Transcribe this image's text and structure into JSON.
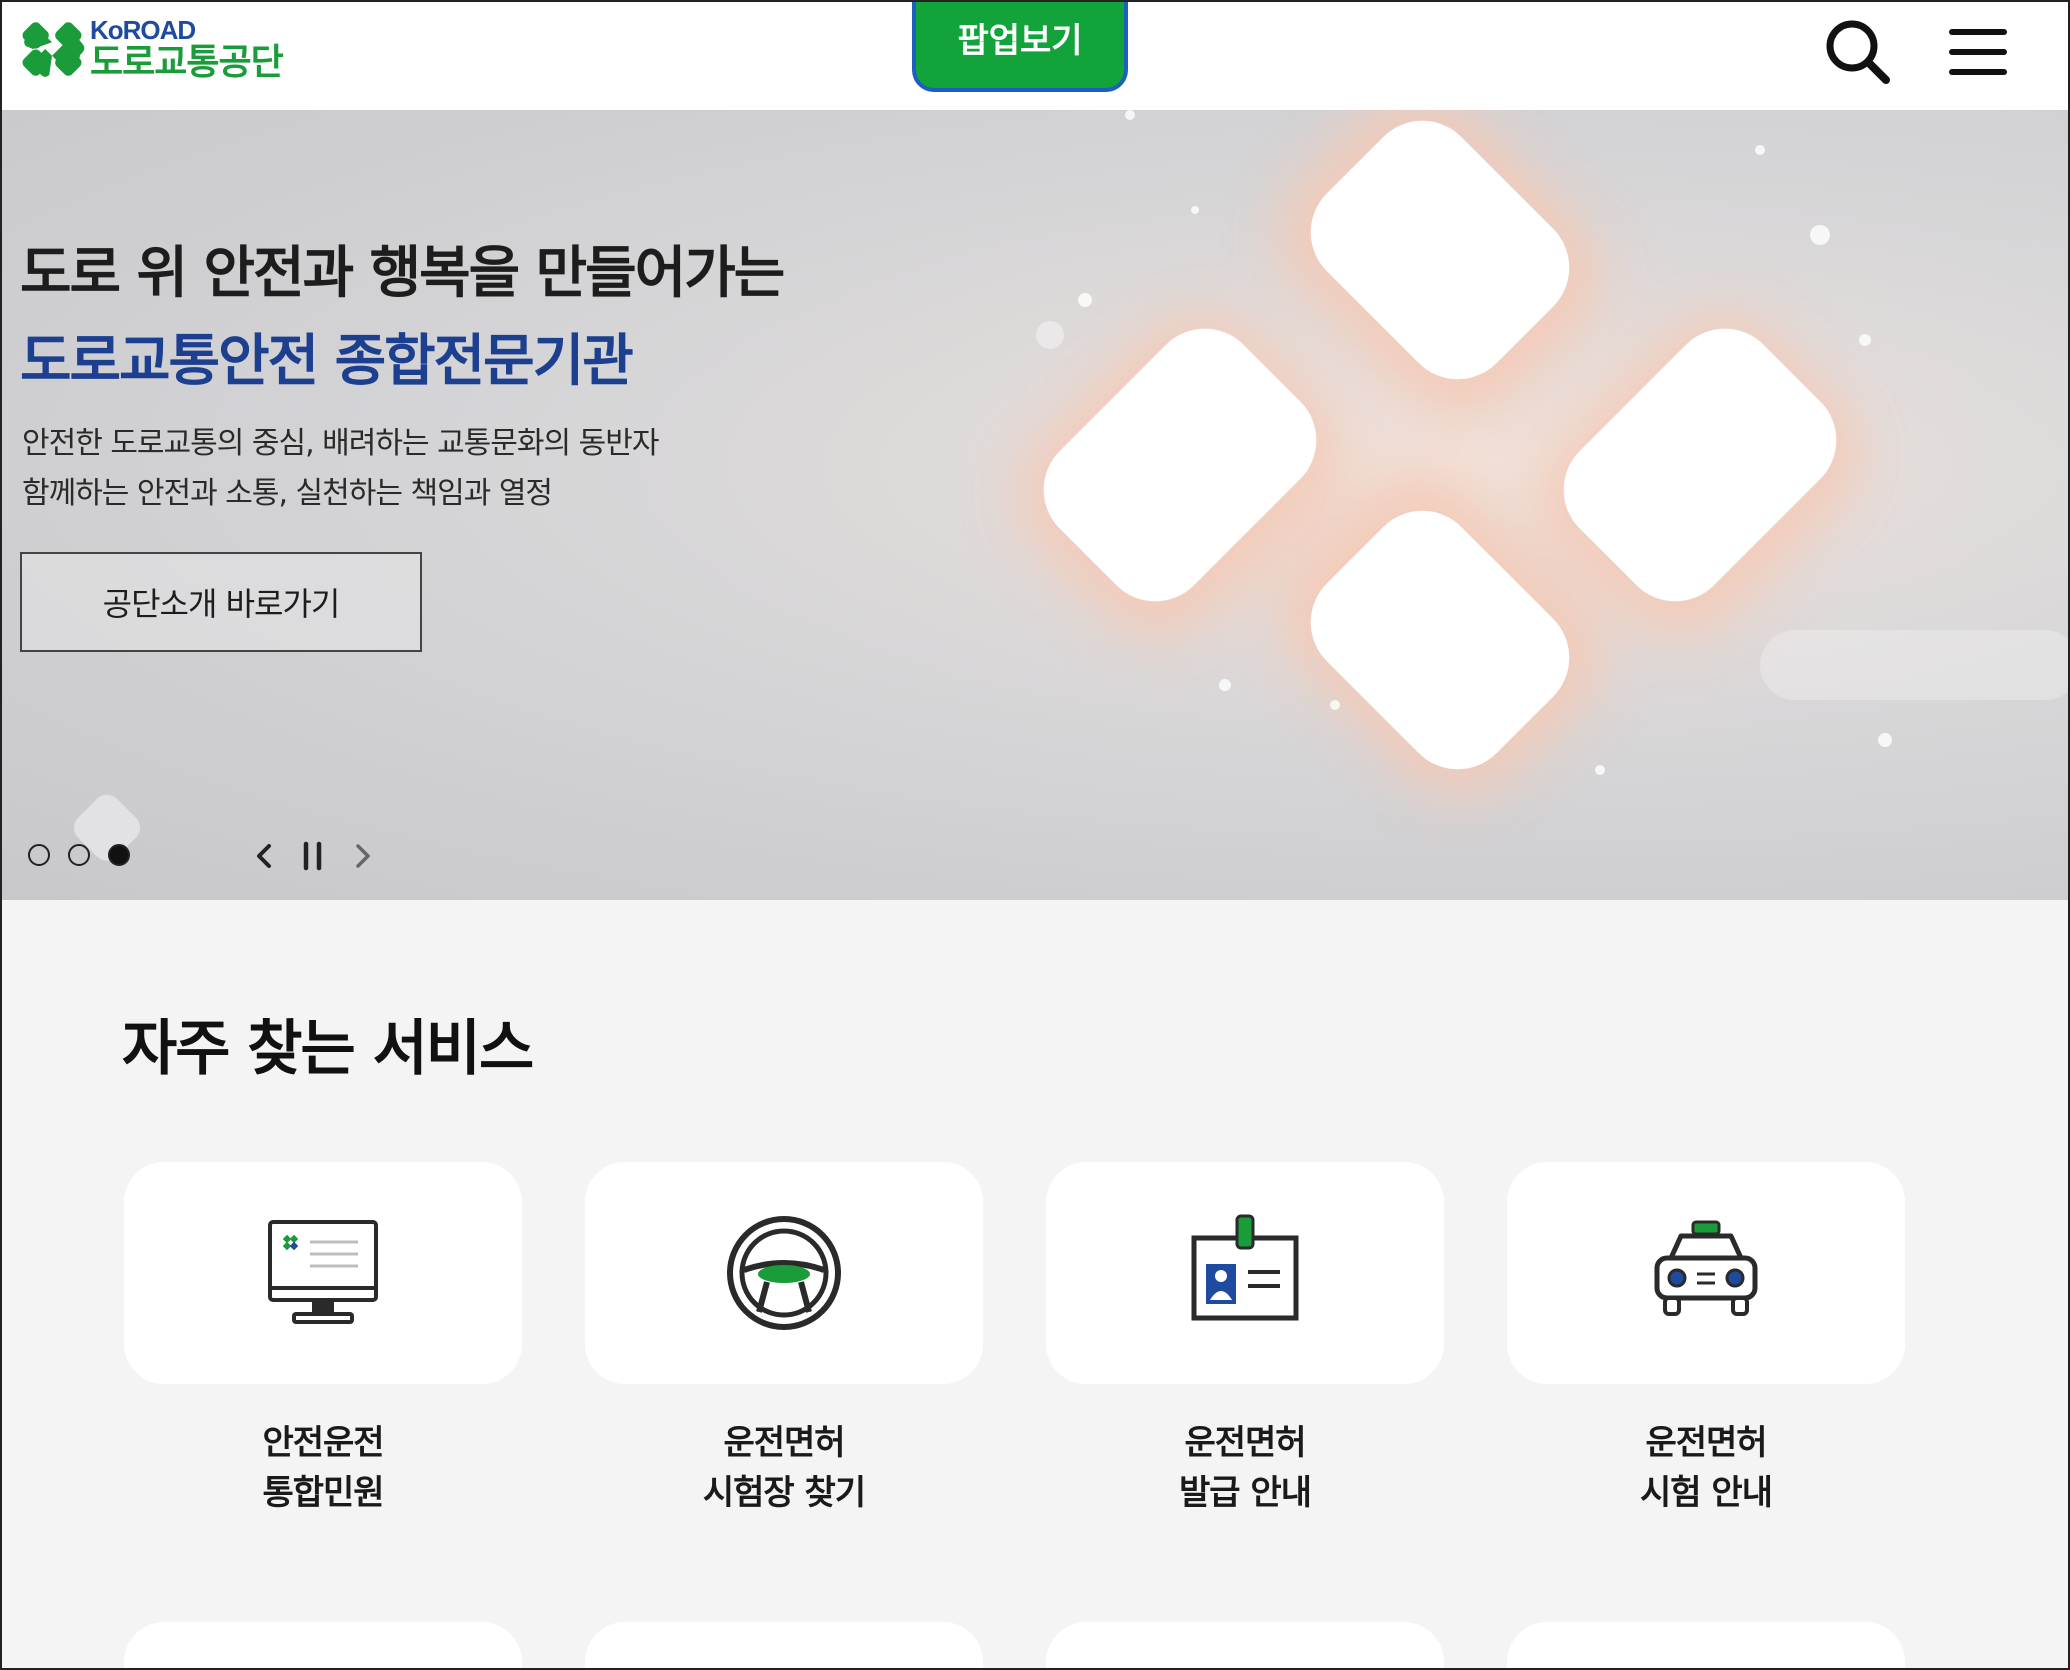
{
  "header": {
    "logo_en": "KoROAD",
    "logo_ko": "도로교통공단",
    "popup_button": "팝업보기"
  },
  "hero": {
    "headline": "도로 위 안전과 행복을 만들어가는",
    "headline_highlight": "도로교통안전 종합전문기관",
    "subtext_line1": "안전한 도로교통의 중심, 배려하는 교통문화의 동반자",
    "subtext_line2": "함께하는 안전과 소통, 실천하는 책임과 열정",
    "cta_label": "공단소개 바로가기",
    "slides": {
      "count": 3,
      "active_index": 3
    }
  },
  "services": {
    "title": "자주 찾는 서비스",
    "items": [
      {
        "line1": "안전운전",
        "line2": "통합민원",
        "icon": "computer-monitor-icon"
      },
      {
        "line1": "운전면허",
        "line2": "시험장 찾기",
        "icon": "steering-wheel-icon"
      },
      {
        "line1": "운전면허",
        "line2": "발급 안내",
        "icon": "id-card-icon"
      },
      {
        "line1": "운전면허",
        "line2": "시험 안내",
        "icon": "taxi-car-icon"
      }
    ]
  },
  "colors": {
    "brand_green": "#12a33a",
    "brand_blue": "#1c3f8f",
    "popup_border": "#1b5fbf",
    "page_bg": "#f4f4f4"
  }
}
